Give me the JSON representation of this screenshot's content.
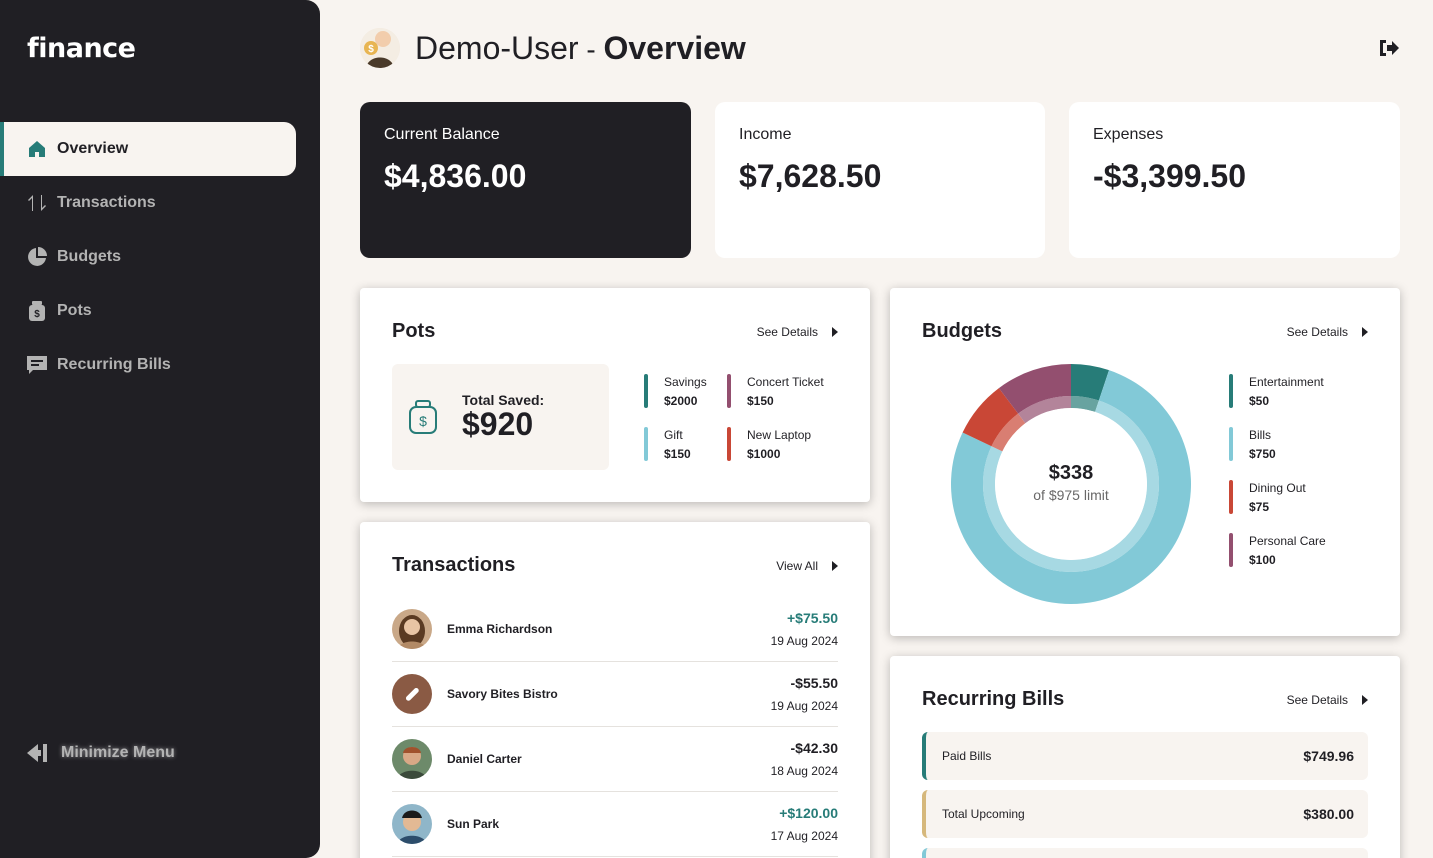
{
  "app": {
    "logo": "finance"
  },
  "nav": {
    "items": [
      {
        "label": "Overview",
        "icon": "home-icon",
        "active": true
      },
      {
        "label": "Transactions",
        "icon": "arrows-updown-icon"
      },
      {
        "label": "Budgets",
        "icon": "pie-chart-icon"
      },
      {
        "label": "Pots",
        "icon": "jar-icon"
      },
      {
        "label": "Recurring Bills",
        "icon": "receipt-icon"
      }
    ],
    "minimize": "Minimize Menu"
  },
  "header": {
    "user": "Demo-User",
    "separator": " - ",
    "page": "Overview"
  },
  "summary": {
    "balance": {
      "label": "Current Balance",
      "value": "$4,836.00"
    },
    "income": {
      "label": "Income",
      "value": "$7,628.50"
    },
    "expenses": {
      "label": "Expenses",
      "value": "-$3,399.50"
    }
  },
  "pots": {
    "title": "Pots",
    "link": "See Details",
    "total_label": "Total Saved:",
    "total_value": "$920",
    "items": [
      {
        "name": "Savings",
        "value": "$2000",
        "color": "#277c78"
      },
      {
        "name": "Concert Ticket",
        "value": "$150",
        "color": "#826cb0"
      },
      {
        "name": "Gift",
        "value": "$150",
        "color": "#82c9d7"
      },
      {
        "name": "New Laptop",
        "value": "$1000",
        "color": "#c94736"
      }
    ]
  },
  "transactions": {
    "title": "Transactions",
    "link": "View All",
    "rows": [
      {
        "name": "Emma Richardson",
        "amount": "+$75.50",
        "date": "19 Aug 2024",
        "positive": true
      },
      {
        "name": "Savory Bites Bistro",
        "amount": "-$55.50",
        "date": "19 Aug 2024",
        "positive": false
      },
      {
        "name": "Daniel Carter",
        "amount": "-$42.30",
        "date": "18 Aug 2024",
        "positive": false
      },
      {
        "name": "Sun Park",
        "amount": "+$120.00",
        "date": "17 Aug 2024",
        "positive": true
      }
    ]
  },
  "budgets": {
    "title": "Budgets",
    "link": "See Details",
    "spent": "$338",
    "limit_text": "of $975 limit",
    "items": [
      {
        "name": "Entertainment",
        "value": "$50",
        "color": "#277c78"
      },
      {
        "name": "Bills",
        "value": "$750",
        "color": "#82c9d7"
      },
      {
        "name": "Dining Out",
        "value": "$75",
        "color": "#c94736"
      },
      {
        "name": "Personal Care",
        "value": "$100",
        "color": "#934f6f"
      }
    ]
  },
  "recurring": {
    "title": "Recurring Bills",
    "link": "See Details",
    "items": [
      {
        "label": "Paid Bills",
        "value": "$749.96",
        "color": "#277c78"
      },
      {
        "label": "Total Upcoming",
        "value": "$380.00",
        "color": "#f2cdac"
      }
    ]
  }
}
